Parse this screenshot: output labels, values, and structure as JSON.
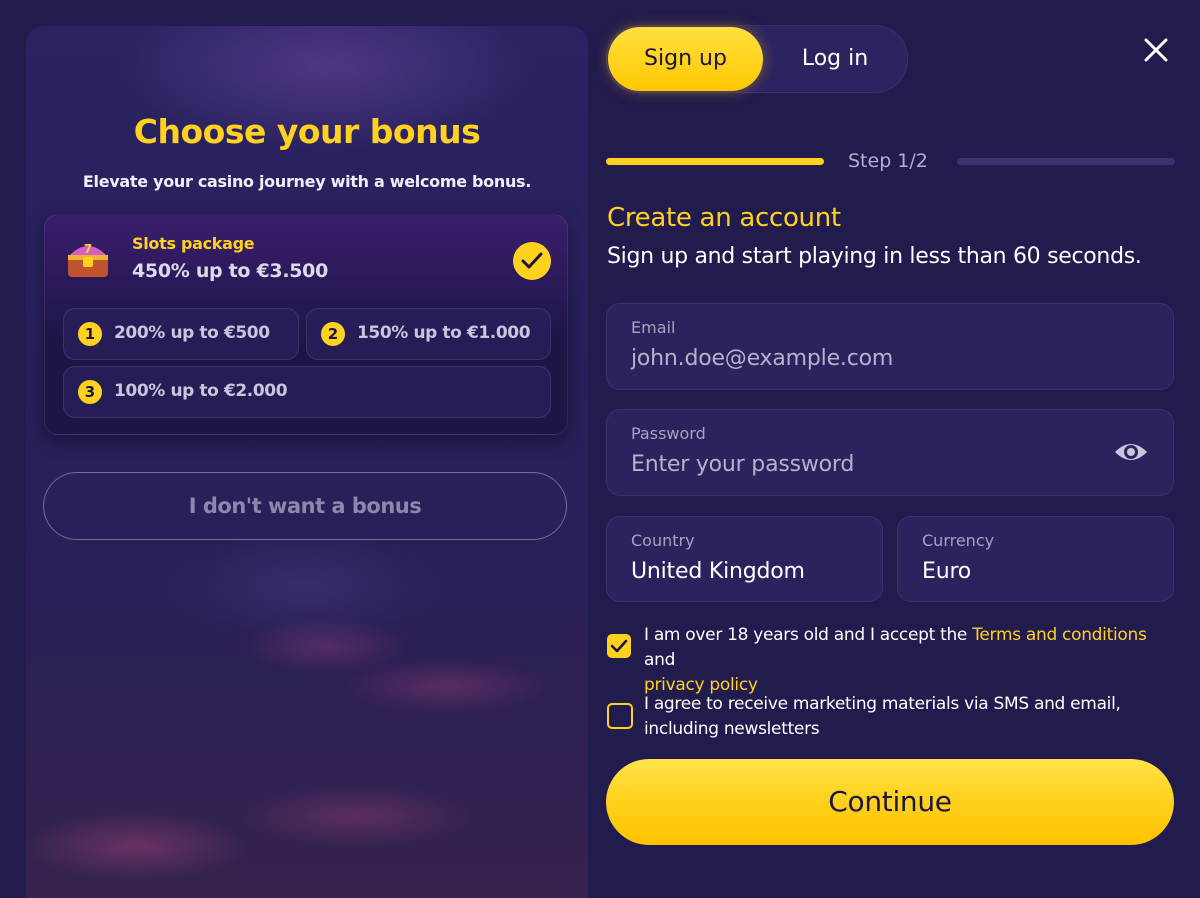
{
  "left": {
    "title": "Choose your bonus",
    "subtitle": "Elevate your casino journey with a welcome bonus.",
    "package": {
      "name": "Slots package",
      "amount": "450% up to €3.500",
      "selected": true,
      "icon": "treasure-chest-icon"
    },
    "tiers": [
      {
        "num": "1",
        "label": "200% up to €500"
      },
      {
        "num": "2",
        "label": "150% up to €1.000"
      },
      {
        "num": "3",
        "label": "100% up to €2.000"
      }
    ],
    "no_bonus_label": "I don't want a bonus"
  },
  "tabs": {
    "signup": "Sign up",
    "login": "Log in",
    "active": "signup"
  },
  "step": {
    "label": "Step 1/2",
    "current": 1,
    "total": 2
  },
  "form": {
    "title": "Create an account",
    "subtitle": "Sign up and start playing in less than 60 seconds.",
    "email": {
      "label": "Email",
      "placeholder": "john.doe@example.com"
    },
    "password": {
      "label": "Password",
      "placeholder": "Enter your password"
    },
    "country": {
      "label": "Country",
      "value": "United Kingdom"
    },
    "currency": {
      "label": "Currency",
      "value": "Euro"
    },
    "terms": {
      "checked": true,
      "text_before": "I am over 18 years old and I accept the ",
      "terms_link": "Terms and conditions",
      "text_mid": " and",
      "privacy_link": "privacy policy"
    },
    "marketing": {
      "checked": false,
      "line1": "I agree to receive marketing materials via SMS and email,",
      "line2": "including newsletters"
    },
    "continue_label": "Continue"
  },
  "colors": {
    "accent": "#ffd21f",
    "background": "#221b4d",
    "field": "#2b235e"
  }
}
